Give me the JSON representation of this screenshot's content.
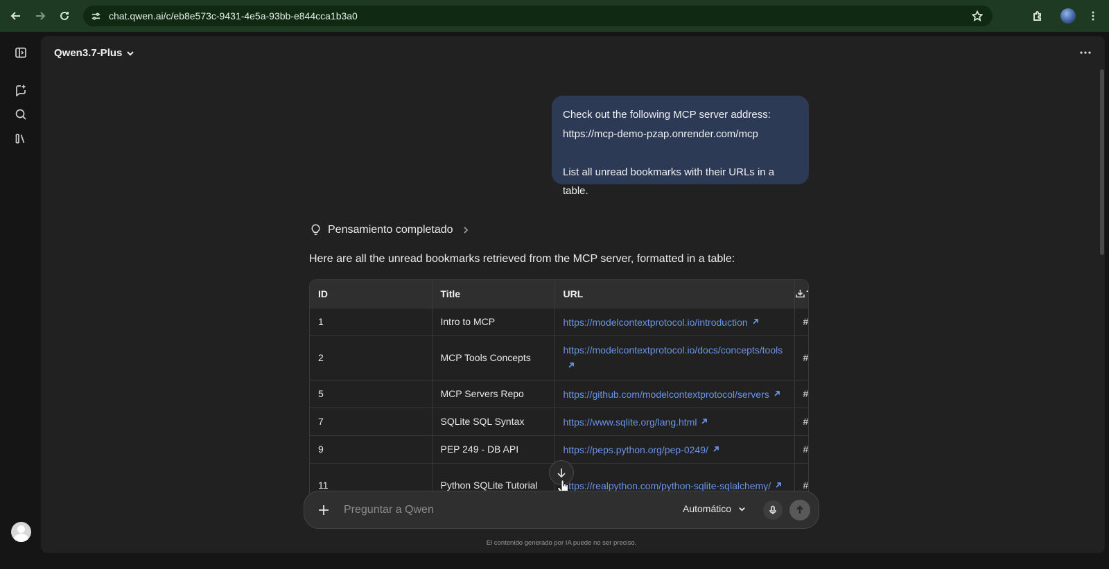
{
  "browser": {
    "url": "chat.qwen.ai/c/eb8e573c-9431-4e5a-93bb-e844cca1b3a0"
  },
  "header": {
    "model_name": "Qwen3.7-Plus"
  },
  "user_message": {
    "line1": "Check out the following MCP server address:",
    "line2": "https://mcp-demo-pzap.onrender.com/mcp",
    "line3": "List all unread bookmarks with their URLs in a table."
  },
  "assistant": {
    "thinking_label": "Pensamiento completado",
    "intro": "Here are all the unread bookmarks retrieved from the MCP server, formatted in a table:",
    "table": {
      "headers": [
        "ID",
        "Title",
        "URL",
        "Ta"
      ],
      "rows": [
        {
          "id": "1",
          "title": "Intro to MCP",
          "url": "https://modelcontextprotocol.io/introduction",
          "tag": "#"
        },
        {
          "id": "2",
          "title": "MCP Tools Concepts",
          "url": "https://modelcontextprotocol.io/docs/concepts/tools",
          "tag": "#"
        },
        {
          "id": "5",
          "title": "MCP Servers Repo",
          "url": "https://github.com/modelcontextprotocol/servers",
          "tag": "#"
        },
        {
          "id": "7",
          "title": "SQLite SQL Syntax",
          "url": "https://www.sqlite.org/lang.html",
          "tag": "#"
        },
        {
          "id": "9",
          "title": "PEP 249 - DB API",
          "url": "https://peps.python.org/pep-0249/",
          "tag": "#"
        },
        {
          "id": "11",
          "title": "Python SQLite Tutorial",
          "url": "https://realpython.com/python-sqlite-sqlalchemy/",
          "tag": "#"
        }
      ]
    }
  },
  "composer": {
    "placeholder": "Preguntar a Qwen",
    "mode": "Automático"
  },
  "footer": {
    "disclaimer": "El contenido generado por IA puede no ser preciso."
  },
  "colors": {
    "chrome": "#1f3a22",
    "bubble": "#2d3a55",
    "link": "#6a93ea",
    "panel": "#212121"
  }
}
